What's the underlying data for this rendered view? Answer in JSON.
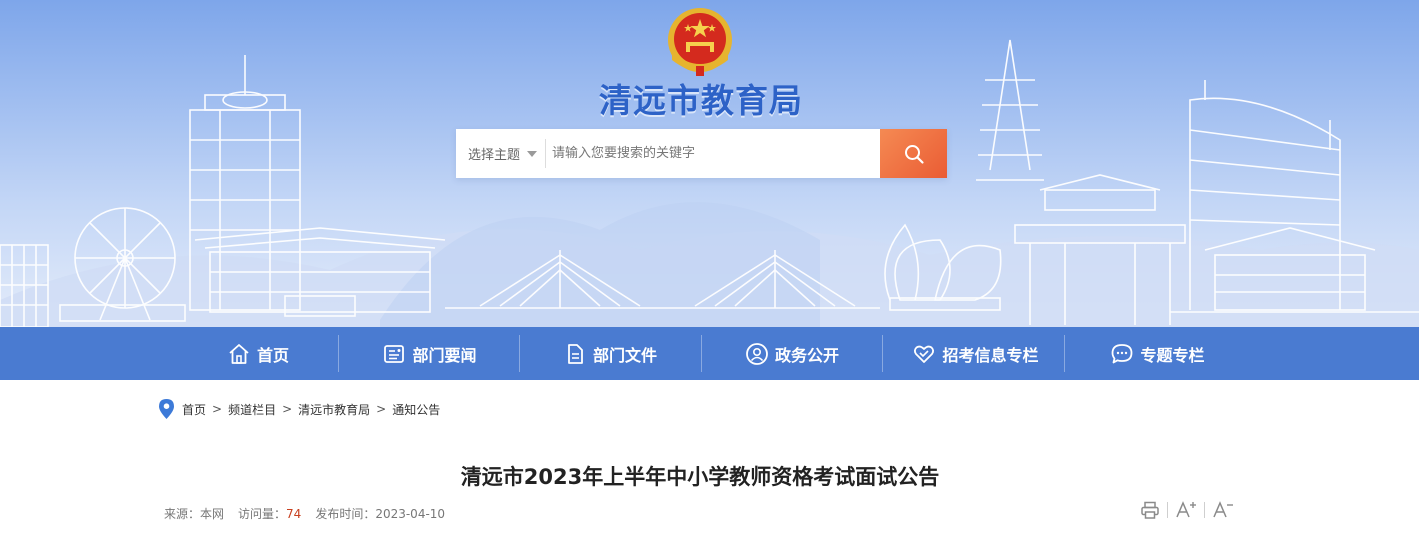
{
  "site": {
    "title": "清远市教育局"
  },
  "search": {
    "topic_label": "选择主题",
    "placeholder": "请输入您要搜索的关键字"
  },
  "nav": {
    "items": [
      {
        "label": "首页",
        "icon": "home-icon"
      },
      {
        "label": "部门要闻",
        "icon": "news-icon"
      },
      {
        "label": "部门文件",
        "icon": "document-icon"
      },
      {
        "label": "政务公开",
        "icon": "user-icon"
      },
      {
        "label": "招考信息专栏",
        "icon": "heart-icon"
      },
      {
        "label": "专题专栏",
        "icon": "chat-icon"
      }
    ]
  },
  "breadcrumb": {
    "items": [
      "首页",
      "频道栏目",
      "清远市教育局",
      "通知公告"
    ],
    "separator": ">"
  },
  "article": {
    "title": "清远市2023年上半年中小学教师资格考试面试公告",
    "source_label": "来源：本网",
    "views_label": "访问量：",
    "views_value": "74",
    "publish_label": "发布时间：2023-04-10"
  },
  "colors": {
    "nav_bg": "#4a7bd1",
    "title_blue": "#2d62c7",
    "search_btn": "#ea5c34",
    "views_red": "#c8401f"
  }
}
